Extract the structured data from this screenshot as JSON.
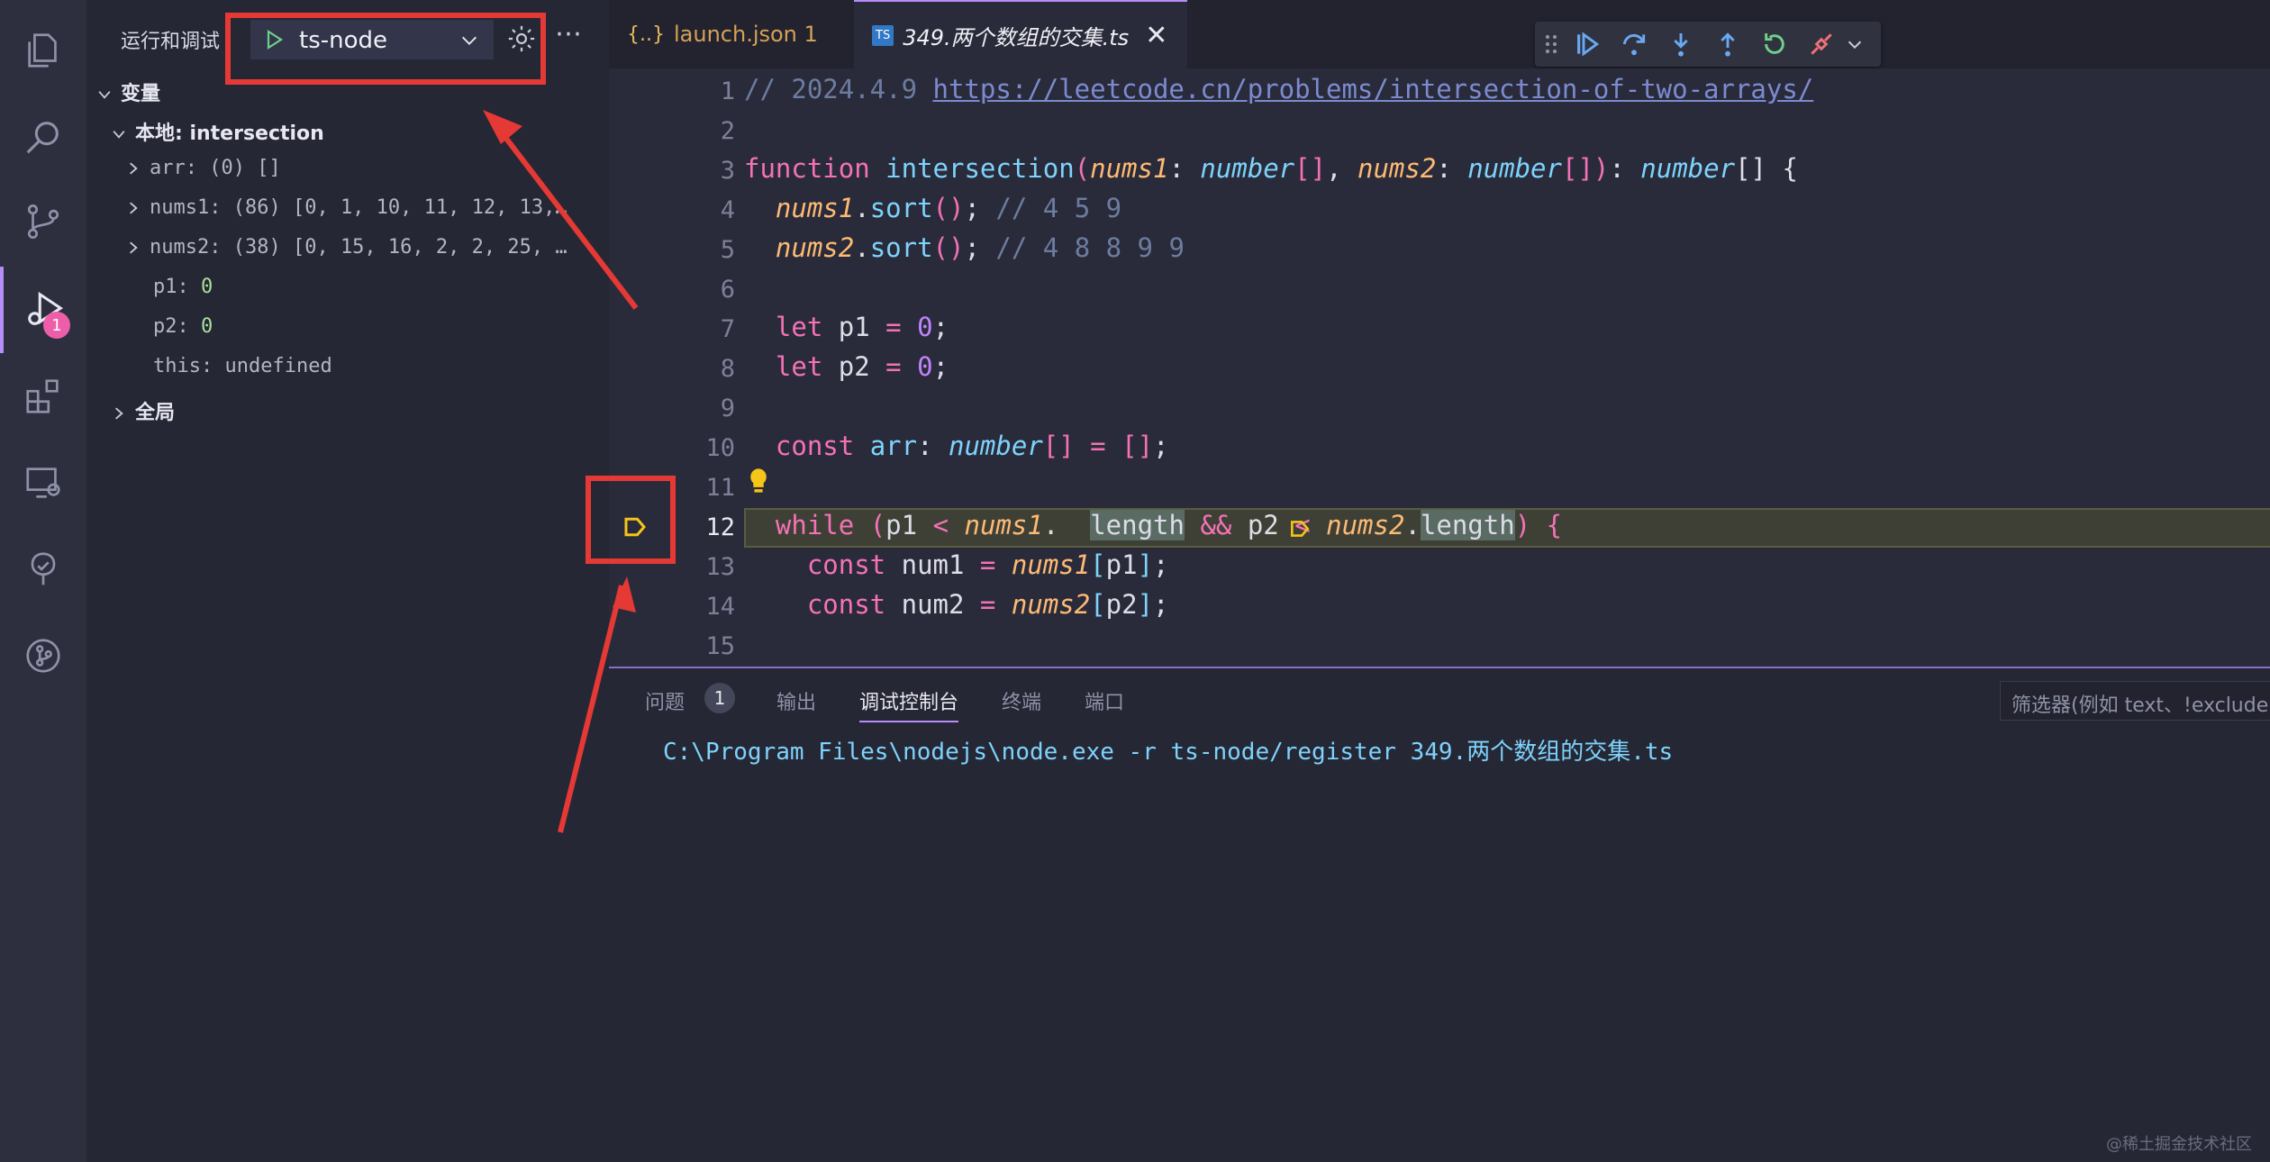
{
  "sidebar": {
    "title": "运行和调试",
    "launch_config": "ts-node",
    "sections": {
      "variables": "变量",
      "local": "本地: intersection",
      "global": "全局"
    },
    "vars": [
      {
        "name": "arr:",
        "value": "(0) []"
      },
      {
        "name": "nums1:",
        "value": "(86) [0, 1, 10, 11, 12, 13,…"
      },
      {
        "name": "nums2:",
        "value": "(38) [0, 15, 16, 2, 2, 25, …"
      },
      {
        "name": "p1:",
        "value": "0"
      },
      {
        "name": "p2:",
        "value": "0"
      },
      {
        "name": "this:",
        "value": "undefined"
      }
    ]
  },
  "activity": {
    "debug_badge": "1"
  },
  "tabs": [
    {
      "icon": "{..}",
      "label": "launch.json 1"
    },
    {
      "icon": "TS",
      "label": "349.两个数组的交集.ts"
    }
  ],
  "editor": {
    "line_numbers": [
      "1",
      "2",
      "3",
      "4",
      "5",
      "6",
      "7",
      "8",
      "9",
      "10",
      "11",
      "12",
      "13",
      "14",
      "15"
    ],
    "comment_date": "// 2024.4.9 ",
    "url": "https://leetcode.cn/problems/intersection-of-two-arrays/"
  },
  "panel": {
    "tabs": [
      "问题",
      "输出",
      "调试控制台",
      "终端",
      "端口"
    ],
    "problems_badge": "1",
    "filter_placeholder": "筛选器(例如 text、!exclude",
    "console_line": "C:\\Program Files\\nodejs\\node.exe -r ts-node/register 349.两个数组的交集.ts"
  },
  "watermark": "@稀土掘金技术社区",
  "colors": {
    "accent": "#b78cf7",
    "annotation": "#e53935",
    "breakpoint": "#f5c518"
  }
}
